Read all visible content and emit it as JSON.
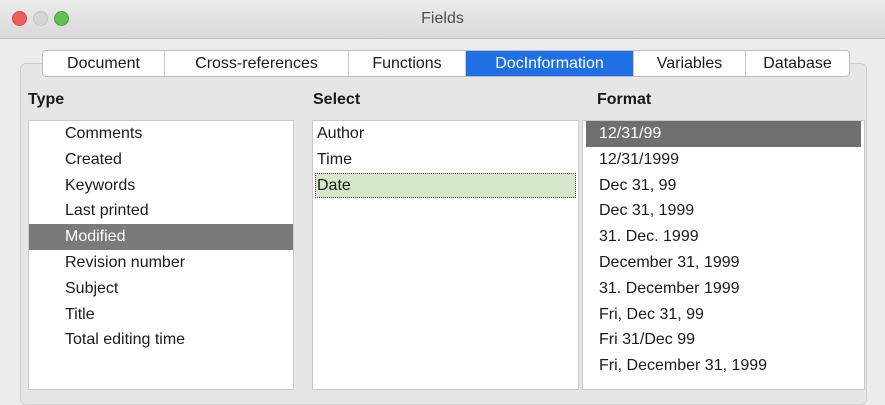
{
  "window": {
    "title": "Fields"
  },
  "tabs": [
    {
      "label": "Document",
      "active": false
    },
    {
      "label": "Cross-references",
      "active": false
    },
    {
      "label": "Functions",
      "active": false
    },
    {
      "label": "DocInformation",
      "active": true
    },
    {
      "label": "Variables",
      "active": false
    },
    {
      "label": "Database",
      "active": false
    }
  ],
  "type": {
    "header": "Type",
    "items": [
      "Comments",
      "Created",
      "Keywords",
      "Last printed",
      "Modified",
      "Revision number",
      "Subject",
      "Title",
      "Total editing time"
    ],
    "selected": "Modified"
  },
  "select": {
    "header": "Select",
    "items": [
      "Author",
      "Time",
      "Date"
    ],
    "selected": "Date"
  },
  "format": {
    "header": "Format",
    "items": [
      "12/31/99",
      "12/31/1999",
      "Dec 31, 99",
      "Dec 31, 1999",
      "31. Dec. 1999",
      "December 31, 1999",
      "31. December 1999",
      "Fri, Dec 31, 99",
      "Fri 31/Dec 99",
      "Fri, December 31, 1999"
    ],
    "selected": "12/31/99"
  },
  "colors": {
    "active_tab": "#1f6fe5",
    "type_selection": "#7a7a7a",
    "select_selection": "#d6e8c9",
    "format_selection": "#6f6f6f"
  }
}
